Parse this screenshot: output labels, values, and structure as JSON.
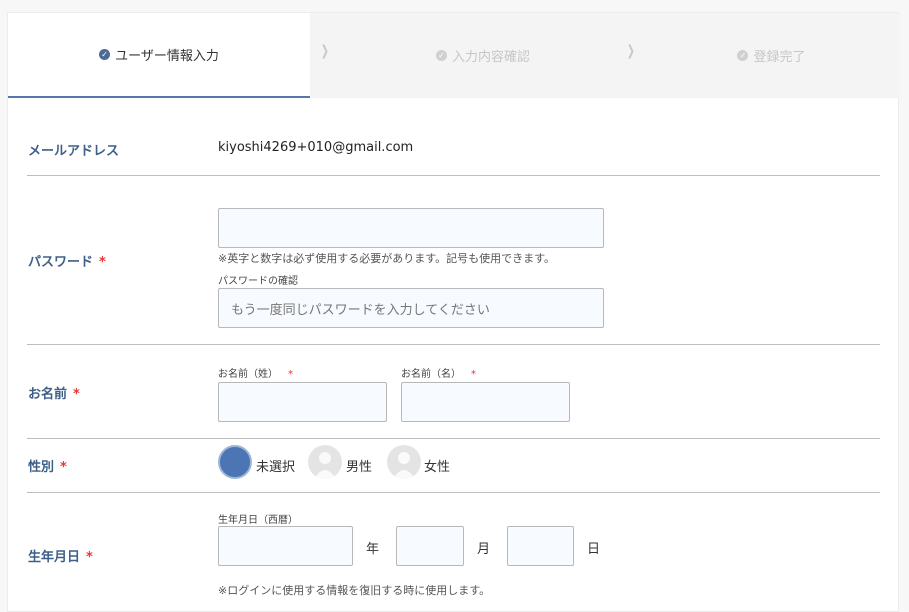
{
  "steps": [
    {
      "label": "ユーザー情報入力",
      "state": "active"
    },
    {
      "label": "入力内容確認",
      "state": "inactive"
    },
    {
      "label": "登録完了",
      "state": "inactive"
    }
  ],
  "email": {
    "label": "メールアドレス",
    "value": "kiyoshi4269+010@gmail.com"
  },
  "password": {
    "label": "パスワード",
    "required_mark": "*",
    "value": "",
    "note": "※英字と数字は必ず使用する必要があります。記号も使用できます。",
    "confirm_label": "パスワードの確認",
    "confirm_placeholder": "もう一度同じパスワードを入力してください"
  },
  "name": {
    "label": "お名前",
    "required_mark": "*",
    "last_label": "お名前（姓）",
    "first_label": "お名前（名）",
    "last_value": "",
    "first_value": ""
  },
  "gender": {
    "label": "性別",
    "required_mark": "*",
    "options": [
      {
        "label": "未選択",
        "selected": true
      },
      {
        "label": "男性",
        "selected": false
      },
      {
        "label": "女性",
        "selected": false
      }
    ]
  },
  "birthday": {
    "label": "生年月日",
    "required_mark": "*",
    "sub_label": "生年月日（西暦）",
    "year_unit": "年",
    "month_unit": "月",
    "day_unit": "日",
    "note": "※ログインに使用する情報を復旧する時に使用します。"
  },
  "icons": {
    "step_check": "check-circle-icon",
    "step_separator": "chevron-right-icon"
  },
  "colors": {
    "accent": "#3e5f88",
    "required": "#ee3333",
    "selected_radio": "#4c75b3"
  }
}
